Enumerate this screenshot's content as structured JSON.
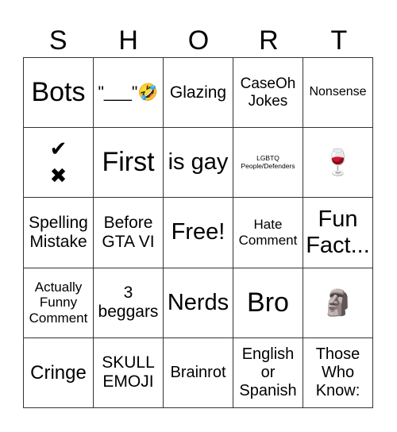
{
  "header": {
    "letters": [
      "S",
      "H",
      "O",
      "R",
      "T"
    ]
  },
  "cells": [
    [
      "Bots",
      "\"___\"🤣",
      "Glazing",
      "CaseOh Jokes",
      "Nonsense"
    ],
    [
      "✔ ✖",
      "First",
      "is gay",
      "LGBTQ People/Defenders",
      "🍷"
    ],
    [
      "Spelling Mistake",
      "Before GTA VI",
      "Free!",
      "Hate Comment",
      "Fun Fact..."
    ],
    [
      "Actually Funny Comment",
      "3 beggars",
      "Nerds",
      "Bro",
      "🗿"
    ],
    [
      "Cringe",
      "SKULL EMOJI",
      "Brainrot",
      "English or Spanish",
      "Those Who Know:"
    ]
  ],
  "check_cross": {
    "check": "✔",
    "cross": "✖"
  },
  "icons": {
    "laughing": "rolling-on-floor-laughing-emoji",
    "wine": "wine-glass-emoji",
    "moai": "moai-emoji"
  }
}
